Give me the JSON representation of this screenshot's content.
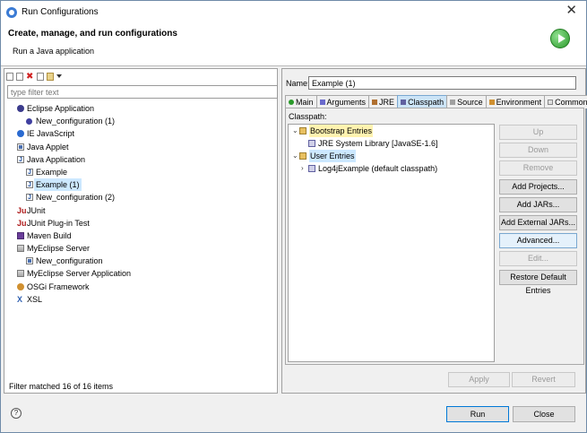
{
  "window": {
    "title": "Run Configurations",
    "close_glyph": "✕"
  },
  "header": {
    "title": "Create, manage, and run configurations",
    "subtitle": "Run a Java application",
    "badge_icon": "run-icon"
  },
  "left": {
    "filter_placeholder": "type filter text",
    "tree": [
      {
        "label": "Eclipse Application",
        "level": 0,
        "icon": "eclipse-icon"
      },
      {
        "label": "New_configuration (1)",
        "level": 1,
        "icon": "config-dot-icon"
      },
      {
        "label": "IE JavaScript",
        "level": 0,
        "icon": "ie-icon"
      },
      {
        "label": "Java Applet",
        "level": 0,
        "icon": "applet-icon"
      },
      {
        "label": "Java Application",
        "level": 0,
        "icon": "java-app-icon"
      },
      {
        "label": "Example",
        "level": 1,
        "icon": "java-config-icon"
      },
      {
        "label": "Example (1)",
        "level": 1,
        "icon": "java-config-icon",
        "selected": true
      },
      {
        "label": "New_configuration (2)",
        "level": 1,
        "icon": "java-config-icon"
      },
      {
        "label": "JUnit",
        "level": 0,
        "icon": "junit-icon"
      },
      {
        "label": "JUnit Plug-in Test",
        "level": 0,
        "icon": "junit-plugin-icon"
      },
      {
        "label": "Maven Build",
        "level": 0,
        "icon": "maven-icon"
      },
      {
        "label": "MyEclipse Server",
        "level": 0,
        "icon": "server-icon"
      },
      {
        "label": "New_configuration",
        "level": 1,
        "icon": "server-config-icon"
      },
      {
        "label": "MyEclipse Server Application",
        "level": 0,
        "icon": "server-app-icon"
      },
      {
        "label": "OSGi Framework",
        "level": 0,
        "icon": "osgi-icon"
      },
      {
        "label": "XSL",
        "level": 0,
        "icon": "xsl-icon"
      }
    ],
    "status": "Filter matched 16 of 16 items"
  },
  "right": {
    "name_label": "Name:",
    "name_value": "Example (1)",
    "tabs": [
      {
        "label": "Main",
        "icon": "main-tab-icon"
      },
      {
        "label": "Arguments",
        "icon": "arguments-tab-icon"
      },
      {
        "label": "JRE",
        "icon": "jre-tab-icon"
      },
      {
        "label": "Classpath",
        "icon": "classpath-tab-icon",
        "active": true
      },
      {
        "label": "Source",
        "icon": "source-tab-icon"
      },
      {
        "label": "Environment",
        "icon": "environment-tab-icon"
      },
      {
        "label": "Common",
        "icon": "common-tab-icon"
      }
    ],
    "classpath_label": "Classpath:",
    "classpath_tree": [
      {
        "label": "Bootstrap Entries",
        "level": 0,
        "arrow": "⌄",
        "highlight": true
      },
      {
        "label": "JRE System Library [JavaSE-1.6]",
        "level": 1,
        "arrow": ""
      },
      {
        "label": "User Entries",
        "level": 0,
        "arrow": "⌄",
        "selected": true
      },
      {
        "label": "Log4jExample (default classpath)",
        "level": 1,
        "arrow": "›"
      }
    ],
    "buttons": [
      {
        "label": "Up",
        "disabled": true
      },
      {
        "label": "Down",
        "disabled": true
      },
      {
        "label": "Remove",
        "disabled": true
      },
      {
        "label": "Add Projects...",
        "disabled": false
      },
      {
        "label": "Add JARs...",
        "disabled": false
      },
      {
        "label": "Add External JARs...",
        "disabled": false
      },
      {
        "label": "Advanced...",
        "disabled": false,
        "focus": true
      },
      {
        "label": "Edit...",
        "disabled": true
      },
      {
        "label": "Restore Default Entries",
        "disabled": false
      }
    ],
    "apply_label": "Apply",
    "revert_label": "Revert"
  },
  "footer": {
    "run_label": "Run",
    "close_label": "Close",
    "help_glyph": "?"
  }
}
